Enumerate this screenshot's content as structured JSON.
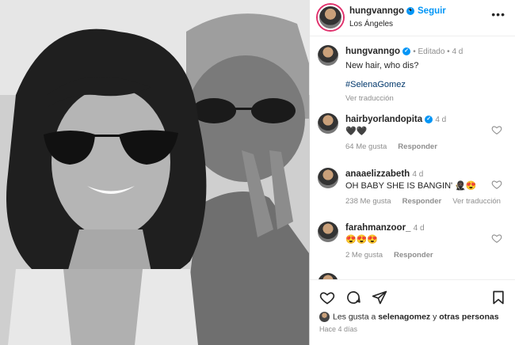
{
  "post": {
    "author": "hungvanngo",
    "follow_label": "Seguir",
    "location": "Los Ángeles",
    "more_label": "•••"
  },
  "caption": {
    "author": "hungvanngo",
    "edited": "Editado",
    "age": "4 d",
    "text": "New hair, who dis?",
    "hashtag": "#SelenaGomez",
    "translate": "Ver traducción"
  },
  "comments": [
    {
      "author": "hairbyorlandopita",
      "verified": true,
      "age": "4 d",
      "text": "🖤🖤",
      "likes": "64 Me gusta",
      "reply": "Responder",
      "translate": ""
    },
    {
      "author": "anaaelizzabeth",
      "verified": false,
      "age": "4 d",
      "text": "OH BABY SHE IS BANGIN' 🥷🏿😍",
      "likes": "238 Me gusta",
      "reply": "Responder",
      "translate": "Ver traducción"
    },
    {
      "author": "farahmanzoor_",
      "verified": false,
      "age": "4 d",
      "text": "😍😍😍",
      "likes": "2 Me gusta",
      "reply": "Responder",
      "translate": ""
    }
  ],
  "footer": {
    "likes_prefix": "Les gusta a ",
    "likes_user": "selenagomez",
    "likes_middle": " y ",
    "likes_others": "otras personas",
    "time": "Hace 4 días"
  },
  "colors": {
    "accent": "#0095f6",
    "verified": "#0095f6",
    "text": "#262626",
    "muted": "#8e8e8e"
  }
}
